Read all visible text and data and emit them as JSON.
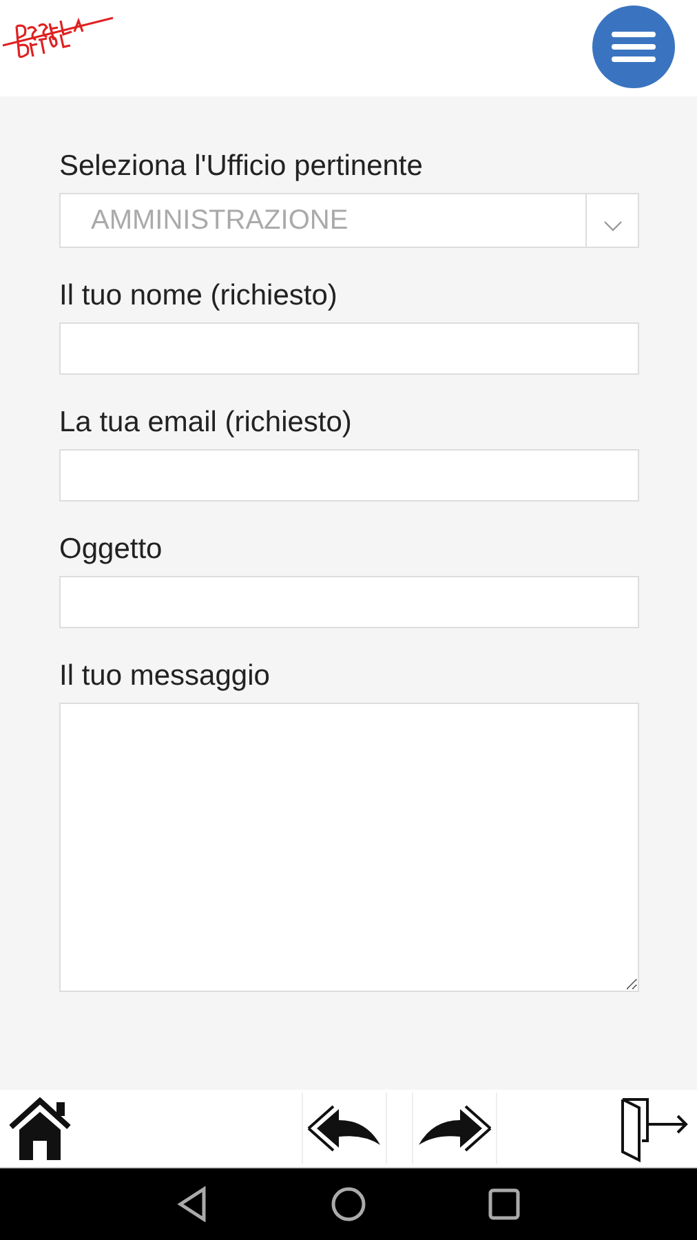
{
  "form": {
    "fields": [
      {
        "kind": "select",
        "label": "Seleziona l'Ufficio pertinente",
        "value": "AMMINISTRAZIONE"
      },
      {
        "kind": "input",
        "label": "Il tuo nome (richiesto)"
      },
      {
        "kind": "input",
        "label": "La tua email (richiesto)"
      },
      {
        "kind": "input",
        "label": "Oggetto"
      },
      {
        "kind": "textarea",
        "label": "Il tuo messaggio"
      }
    ]
  }
}
